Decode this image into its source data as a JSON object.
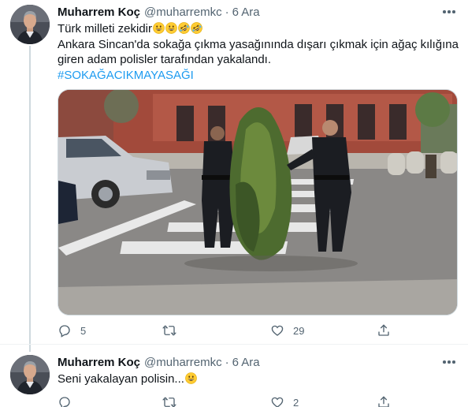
{
  "tweets": [
    {
      "name": "Muharrem Koç",
      "handle": "@muharremkc",
      "separator": "·",
      "date": "6 Ara",
      "line1": "Türk milleti zekidir",
      "line2": "Ankara Sincan'da sokağa çıkma yasağınında dışarı çıkmak için ağaç kılığına",
      "line3": "giren adam polisler tarafından yakalandı.",
      "hashtag": "#SOKAĞACIKMAYASAĞI",
      "emojis": [
        "grinning-face",
        "grinning-face",
        "rolling-laughing-face",
        "rolling-laughing-face"
      ],
      "replies": "5",
      "retweets": "",
      "likes": "29",
      "photo_description": "Two police officers escorting a man disguised as a tree across a crosswalk"
    },
    {
      "name": "Muharrem Koç",
      "handle": "@muharremkc",
      "separator": "·",
      "date": "6 Ara",
      "line1": "Seni yakalayan polisin...",
      "emojis": [
        "grinning-face"
      ],
      "replies": "",
      "retweets": "",
      "likes": "2"
    }
  ],
  "colors": {
    "link": "#1d9bf0",
    "secondary_text": "#536471",
    "thread_line": "#cfd9de"
  }
}
